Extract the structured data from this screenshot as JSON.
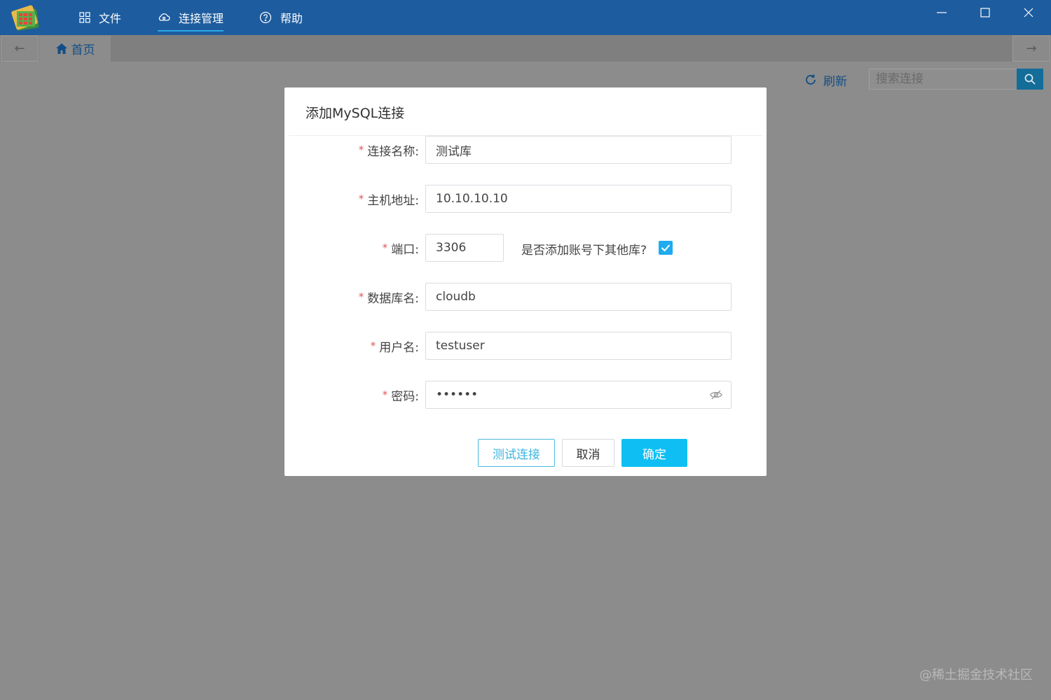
{
  "menu": {
    "file": "文件",
    "connections": "连接管理",
    "help": "帮助"
  },
  "nav": {
    "back": "←",
    "forward": "→"
  },
  "tab": {
    "home": "首页"
  },
  "toolbar": {
    "refresh": "刷新",
    "search_placeholder": "搜索连接"
  },
  "dialog": {
    "title": "添加MySQL连接",
    "required_mark": "*",
    "fields": {
      "name": {
        "label": "连接名称:",
        "value": "测试库"
      },
      "host": {
        "label": "主机地址:",
        "value": "10.10.10.10"
      },
      "port": {
        "label": "端口:",
        "value": "3306"
      },
      "database": {
        "label": "数据库名:",
        "value": "cloudb"
      },
      "username": {
        "label": "用户名:",
        "value": "testuser"
      },
      "password": {
        "label": "密码:",
        "value": "••••••"
      }
    },
    "add_other_dbs": {
      "label": "是否添加账号下其他库?",
      "checked": true
    },
    "buttons": {
      "test": "测试连接",
      "cancel": "取消",
      "ok": "确定"
    }
  },
  "watermark": "@稀土掘金技术社区",
  "colors": {
    "titlebar": "#1d5c9e",
    "accent": "#0fbff3",
    "overlay": "#8c8c8c"
  }
}
